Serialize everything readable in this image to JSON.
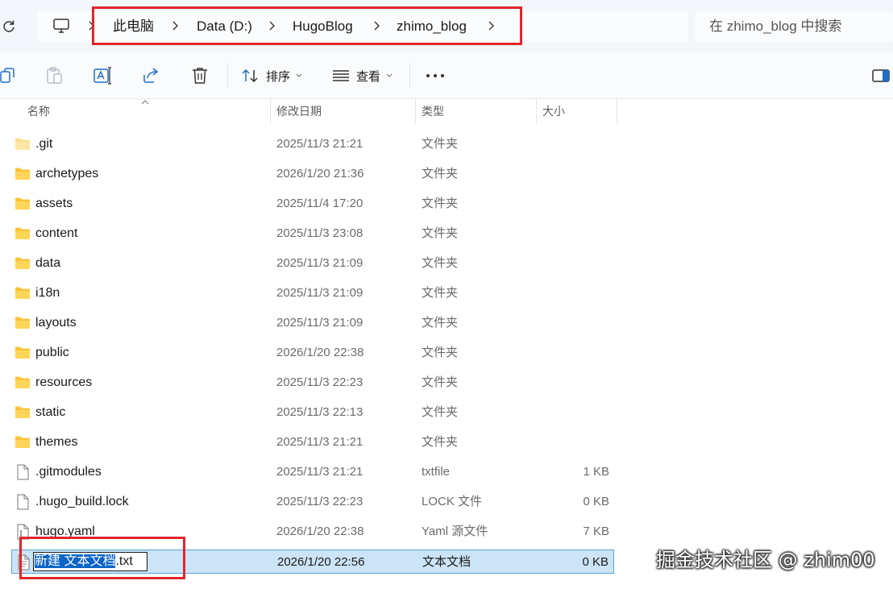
{
  "breadcrumb": {
    "items": [
      "此电脑",
      "Data (D:)",
      "HugoBlog",
      "zhimo_blog"
    ]
  },
  "search": {
    "placeholder": "在 zhimo_blog 中搜索"
  },
  "toolbar": {
    "sort_label": "排序",
    "view_label": "查看"
  },
  "columns": {
    "name": "名称",
    "modified": "修改日期",
    "type": "类型",
    "size": "大小"
  },
  "files": [
    {
      "name": ".git",
      "modified": "2025/11/3 21:21",
      "type": "文件夹",
      "size": "",
      "icon": "folder-icon",
      "faded": true
    },
    {
      "name": "archetypes",
      "modified": "2026/1/20 21:36",
      "type": "文件夹",
      "size": "",
      "icon": "folder-icon"
    },
    {
      "name": "assets",
      "modified": "2025/11/4 17:20",
      "type": "文件夹",
      "size": "",
      "icon": "folder-icon"
    },
    {
      "name": "content",
      "modified": "2025/11/3 23:08",
      "type": "文件夹",
      "size": "",
      "icon": "folder-icon"
    },
    {
      "name": "data",
      "modified": "2025/11/3 21:09",
      "type": "文件夹",
      "size": "",
      "icon": "folder-icon"
    },
    {
      "name": "i18n",
      "modified": "2025/11/3 21:09",
      "type": "文件夹",
      "size": "",
      "icon": "folder-icon"
    },
    {
      "name": "layouts",
      "modified": "2025/11/3 21:09",
      "type": "文件夹",
      "size": "",
      "icon": "folder-icon"
    },
    {
      "name": "public",
      "modified": "2026/1/20 22:38",
      "type": "文件夹",
      "size": "",
      "icon": "folder-icon"
    },
    {
      "name": "resources",
      "modified": "2025/11/3 22:23",
      "type": "文件夹",
      "size": "",
      "icon": "folder-icon"
    },
    {
      "name": "static",
      "modified": "2025/11/3 22:13",
      "type": "文件夹",
      "size": "",
      "icon": "folder-icon"
    },
    {
      "name": "themes",
      "modified": "2025/11/3 21:21",
      "type": "文件夹",
      "size": "",
      "icon": "folder-icon"
    },
    {
      "name": ".gitmodules",
      "modified": "2025/11/3 21:21",
      "type": "txtfile",
      "size": "1 KB",
      "icon": "file-icon"
    },
    {
      "name": ".hugo_build.lock",
      "modified": "2025/11/3 22:23",
      "type": "LOCK 文件",
      "size": "0 KB",
      "icon": "file-icon"
    },
    {
      "name": "hugo.yaml",
      "modified": "2026/1/20 22:38",
      "type": "Yaml 源文件",
      "size": "7 KB",
      "icon": "yaml-file-icon"
    },
    {
      "name": "新建 文本文档.txt",
      "modified": "2026/1/20 22:56",
      "type": "文本文档",
      "size": "0 KB",
      "icon": "text-file-icon",
      "selected": true,
      "rename_selected": "新建 文本文档",
      "rename_rest": ".txt"
    }
  ],
  "watermark": "掘金技术社区 @ zhim00",
  "colors": {
    "highlight_border": "#e0262b",
    "selection_bg": "#cce4f7",
    "selection_border": "#5aa2d8",
    "text_selection": "#0a64c8",
    "folder": "#f8c33a"
  }
}
